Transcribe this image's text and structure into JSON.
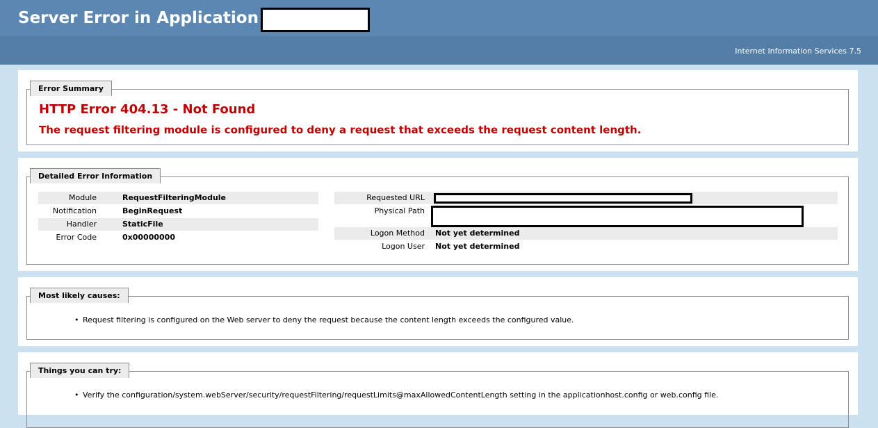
{
  "header": {
    "title": "Server Error in Application"
  },
  "subheader": {
    "server_name": "Internet Information Services 7.5"
  },
  "summary": {
    "legend": "Error Summary",
    "title": "HTTP Error 404.13 - Not Found",
    "description": "The request filtering module is configured to deny a request that exceeds the request content length."
  },
  "details": {
    "legend": "Detailed Error Information",
    "left": [
      {
        "label": "Module",
        "value": "RequestFilteringModule"
      },
      {
        "label": "Notification",
        "value": "BeginRequest"
      },
      {
        "label": "Handler",
        "value": "StaticFile"
      },
      {
        "label": "Error Code",
        "value": "0x00000000"
      }
    ],
    "right": [
      {
        "label": "Requested URL",
        "value": ""
      },
      {
        "label": "Physical Path",
        "value": ""
      },
      {
        "label": "Logon Method",
        "value": "Not yet determined"
      },
      {
        "label": "Logon User",
        "value": "Not yet determined"
      }
    ]
  },
  "causes": {
    "legend": "Most likely causes:",
    "items": [
      "Request filtering is configured on the Web server to deny the request because the content length exceeds the configured value."
    ]
  },
  "try": {
    "legend": "Things you can try:",
    "items": [
      "Verify the configuration/system.webServer/security/requestFiltering/requestLimits@maxAllowedContentLength setting in the applicationhost.config or web.config file."
    ]
  }
}
